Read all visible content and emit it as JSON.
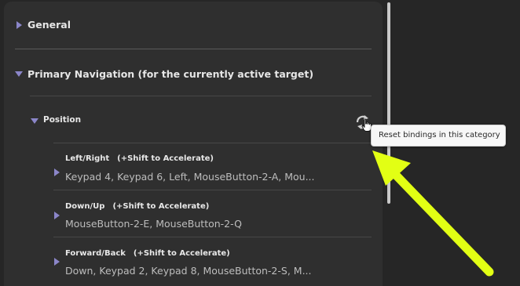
{
  "colors": {
    "accent_triangle": "#8b86c9",
    "arrow": "#e2ff14",
    "panel_bg": "#2f2f2f",
    "page_bg": "#262626",
    "tooltip_bg": "#f7f7f7"
  },
  "icons": {
    "reset": "refresh-arrows-icon",
    "cursor": "hand-pointer-icon"
  },
  "sections": {
    "general": {
      "label": "General",
      "expanded": false
    },
    "primary_navigation": {
      "label": "Primary Navigation (for the currently active target)",
      "expanded": true
    }
  },
  "category": {
    "label": "Position",
    "expanded": true,
    "reset_tooltip": "Reset bindings in this category"
  },
  "bindings": [
    {
      "title": "Left/Right",
      "hint": "(+Shift to Accelerate)",
      "keys": "Keypad 4, Keypad 6, Left, MouseButton-2-A, Mou..."
    },
    {
      "title": "Down/Up",
      "hint": "(+Shift to Accelerate)",
      "keys": "MouseButton-2-E, MouseButton-2-Q"
    },
    {
      "title": "Forward/Back",
      "hint": "(+Shift to Accelerate)",
      "keys": "Down, Keypad 2, Keypad 8, MouseButton-2-S, M..."
    }
  ]
}
